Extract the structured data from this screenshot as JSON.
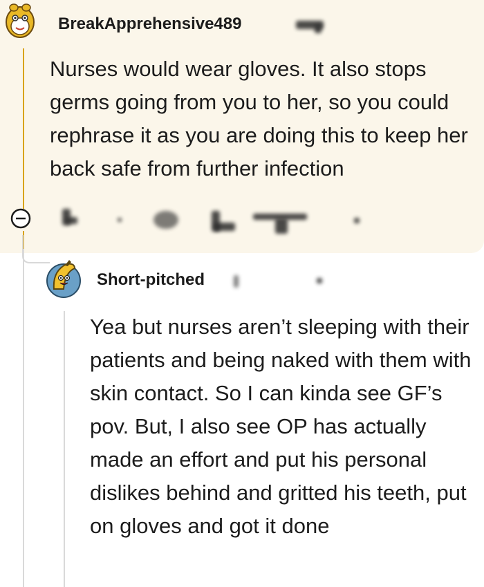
{
  "parent_comment": {
    "username": "BreakApprehensive489",
    "body": "Nurses would wear gloves. It also stops germs going from you to her, so you could rephrase it as you are doing this to keep her back safe from further infection"
  },
  "reply_comment": {
    "username": "Short-pitched",
    "body": "Yea but nurses aren’t sleeping with their patients and being naked with them with skin contact. So I can kinda see GF’s pov. But, I also see OP has actually made an effort and put his personal dislikes behind and gritted his teeth, put on gloves and got it done"
  },
  "colors": {
    "highlight_background": "#fbf6ea",
    "thread_line_active": "#d8a31a",
    "thread_line": "#d9d9d9",
    "text": "#1c1c1c"
  },
  "icons": {
    "parent_avatar": "snoo-avatar-icon",
    "reply_avatar": "banana-avatar-icon",
    "collapse": "collapse-minus-icon"
  }
}
